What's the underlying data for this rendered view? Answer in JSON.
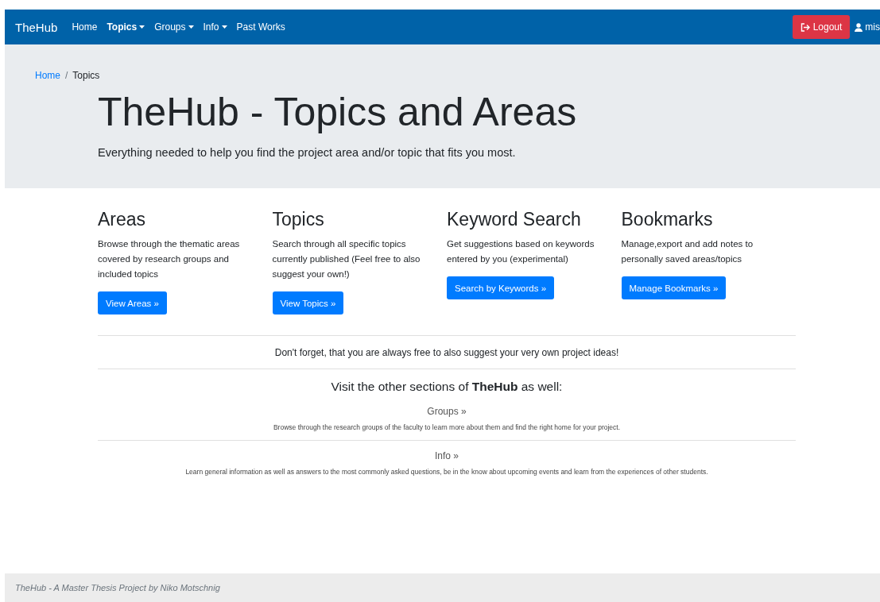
{
  "navbar": {
    "brand": "TheHub",
    "items": [
      {
        "label": "Home",
        "selected": false,
        "dropdown": false
      },
      {
        "label": "Topics",
        "selected": true,
        "dropdown": true
      },
      {
        "label": "Groups",
        "selected": false,
        "dropdown": true
      },
      {
        "label": "Info",
        "selected": false,
        "dropdown": true
      },
      {
        "label": "Past Works",
        "selected": false,
        "dropdown": false
      }
    ],
    "logout": "Logout",
    "user": "mis"
  },
  "breadcrumb_separator": "/",
  "breadcrumb": [
    {
      "label": "Home",
      "selected": false
    },
    {
      "label": "Topics",
      "selected": true
    }
  ],
  "hero": {
    "title": "TheHub - Topics and Areas",
    "subtitle": "Everything needed to help you find the project area and/or topic that fits you most."
  },
  "cards": [
    {
      "title": "Areas",
      "text": "Browse through the thematic areas covered by research groups and included topics",
      "button": "View Areas »"
    },
    {
      "title": "Topics",
      "text": "Search through all specific topics currently published (Feel free to also suggest your own!)",
      "button": "View Topics »"
    },
    {
      "title": "Keyword Search",
      "text": "Get suggestions based on keywords entered by you (experimental)",
      "button": "Search by Keywords »"
    },
    {
      "title": "Bookmarks",
      "text": "Manage,export and add notes to personally saved areas/topics",
      "button": "Manage Bookmarks »"
    }
  ],
  "notice": "Don't forget, that you are always free to also suggest your very own project ideas!",
  "sections_heading": "Visit the other sections of **TheHub** as well:",
  "sections": [
    {
      "link": "Groups »",
      "text": "Browse through the research groups of the faculty to learn more about them and find the right home for your project."
    },
    {
      "link": "Info »",
      "text": "Learn general information as well as answers to the most commonly asked questions, be in the know about upcoming events and learn from the experiences of other students."
    }
  ],
  "footer": "TheHub - A Master Thesis Project by Niko Motschnig"
}
